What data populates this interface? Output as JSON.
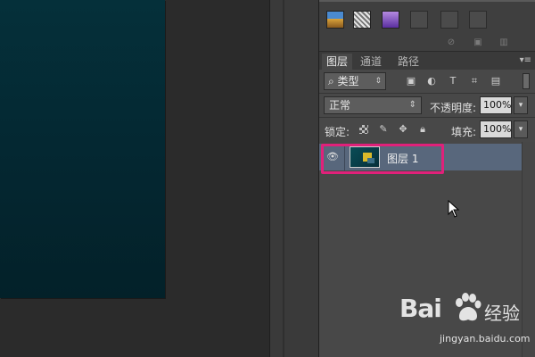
{
  "tabs": [
    {
      "label": "图层"
    },
    {
      "label": "通道"
    },
    {
      "label": "路径"
    }
  ],
  "tab_menu_icon": "panel-menu-icon",
  "filter": {
    "kind_label": "类型",
    "icons": [
      "image-filter-icon",
      "adjustment-filter-icon",
      "type-filter-icon",
      "shape-filter-icon",
      "smart-object-filter-icon"
    ]
  },
  "blend": {
    "mode": "正常",
    "opacity_label": "不透明度:",
    "opacity_value": "100%"
  },
  "lock": {
    "label": "锁定:",
    "fill_label": "填充:",
    "fill_value": "100%",
    "icons": [
      "lock-transparent-icon",
      "lock-image-icon",
      "lock-position-icon",
      "lock-all-icon"
    ]
  },
  "layers": [
    {
      "name": "图层 1",
      "visible": true,
      "selected": true
    }
  ],
  "highlight_color": "#e0217a",
  "selected_row_color": "#58677c",
  "watermark": {
    "logo_text": "Bai",
    "logo_cn": "经验",
    "url": "jingyan.baidu.com"
  }
}
